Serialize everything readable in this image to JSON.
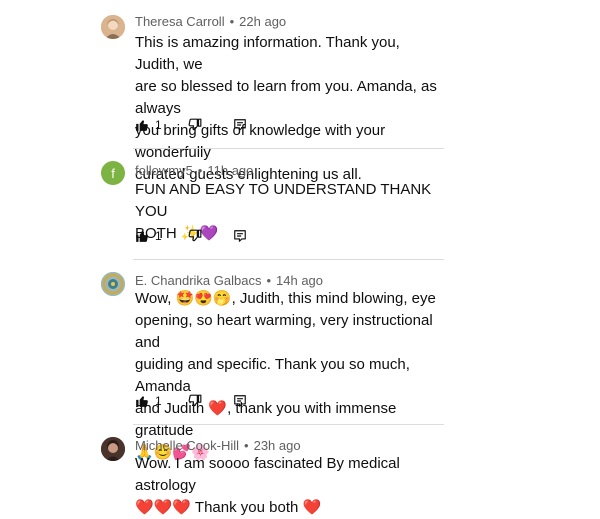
{
  "comments": [
    {
      "author": "Theresa Carroll",
      "time": "22h ago",
      "lines": [
        "This is amazing information. Thank you, Judith, we",
        "are so blessed to learn from you. Amanda, as always",
        "you bring gifts of knowledge with your wonderfully",
        "curated guests enlightening us all."
      ],
      "likes": "1",
      "avatar_color": "#c9a27a"
    },
    {
      "author": "followmy5",
      "time": "11h ago",
      "avatar_letter": "f",
      "lines": [
        "FUN AND  EASY TO UNDERSTAND THANK YOU",
        "BOTH ✨💜"
      ],
      "likes": "1",
      "avatar_color": "#7cb342"
    },
    {
      "author": "E. Chandrika Galbacs",
      "time": "14h ago",
      "lines": [
        "Wow, 🤩😍🤭, Judith, this mind blowing, eye",
        "opening, so heart warming, very instructional and",
        "guiding and specific. Thank you so much, Amanda",
        "and Judith ❤️, thank you with immense gratitude",
        "🙏😊💕🌸"
      ],
      "likes": "1",
      "avatar_color": "#8aa8a0"
    },
    {
      "author": "Michelle Cook-Hill",
      "time": "23h ago",
      "lines": [
        "Wow. I am soooo fascinated By medical astrology",
        "❤️❤️❤️  Thank you both ❤️"
      ],
      "avatar_color": "#5a4035"
    }
  ],
  "separator": "•",
  "icons": {
    "like": "thumbs-up-filled-icon",
    "dislike": "thumbs-down-outline-icon",
    "reply": "reply-comment-icon"
  }
}
